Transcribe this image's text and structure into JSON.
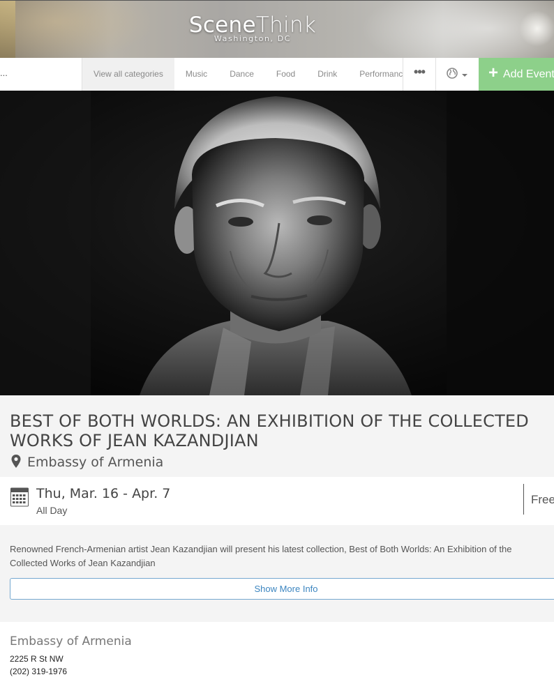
{
  "header": {
    "logo_main_bold": "Scene",
    "logo_main_light": "Think",
    "logo_city": "Washington, DC"
  },
  "nav": {
    "search_value": "...",
    "categories": [
      "View all categories",
      "Music",
      "Dance",
      "Food",
      "Drink",
      "Performance"
    ],
    "more_icon": "ellipsis-icon",
    "globe_icon": "globe-icon",
    "add_event_label": "Add Event"
  },
  "hero": {
    "image_description_icon": "event-photo"
  },
  "event": {
    "title": "BEST OF BOTH WORLDS: AN EXHIBITION OF THE COLLECTED WORKS OF JEAN KAZANDJIAN",
    "venue": "Embassy of Armenia",
    "date": "Thu, Mar. 16 - Apr. 7",
    "time": "All Day",
    "price": "Free",
    "description": "Renowned French-Armenian artist Jean Kazandjian will present his latest collection, Best of Both Worlds: An Exhibition of the Collected Works of Jean Kazandjian",
    "more_info_label": "Show More Info"
  },
  "venue_box": {
    "name": "Embassy of Armenia",
    "address": "2225 R St NW",
    "phone": "(202) 319-1976"
  },
  "colors": {
    "accent_green": "#8dd08a",
    "link_blue": "#3d86c0"
  }
}
